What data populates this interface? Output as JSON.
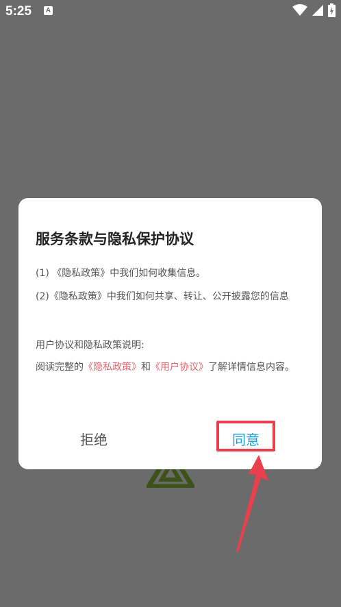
{
  "status_bar": {
    "time": "5:25",
    "app_icon_label": "A"
  },
  "dialog": {
    "title": "服务条款与隐私保护协议",
    "item1": "(1) 《隐私政策》中我们如何收集信息。",
    "item2": "(2)《隐私政策》中我们如何共享、转让、公开披露您的信息",
    "intro": "用户协议和隐私政策说明:",
    "read_prefix": "阅读完整的",
    "privacy_link": "《隐私政策》",
    "and_text": "和",
    "user_link": "《用户协议》",
    "read_suffix": "了解详情信息内容。",
    "reject_label": "拒绝",
    "agree_label": "同意"
  },
  "colors": {
    "overlay": "#6b6b6b",
    "link": "#e8646c",
    "agree": "#1aa0e0",
    "highlight": "#ea3f4d",
    "logo": "#3d5218"
  },
  "icons": [
    "wifi-icon",
    "signal-icon",
    "battery-icon",
    "arrow-annotation-icon",
    "logo-triangle-icon"
  ]
}
